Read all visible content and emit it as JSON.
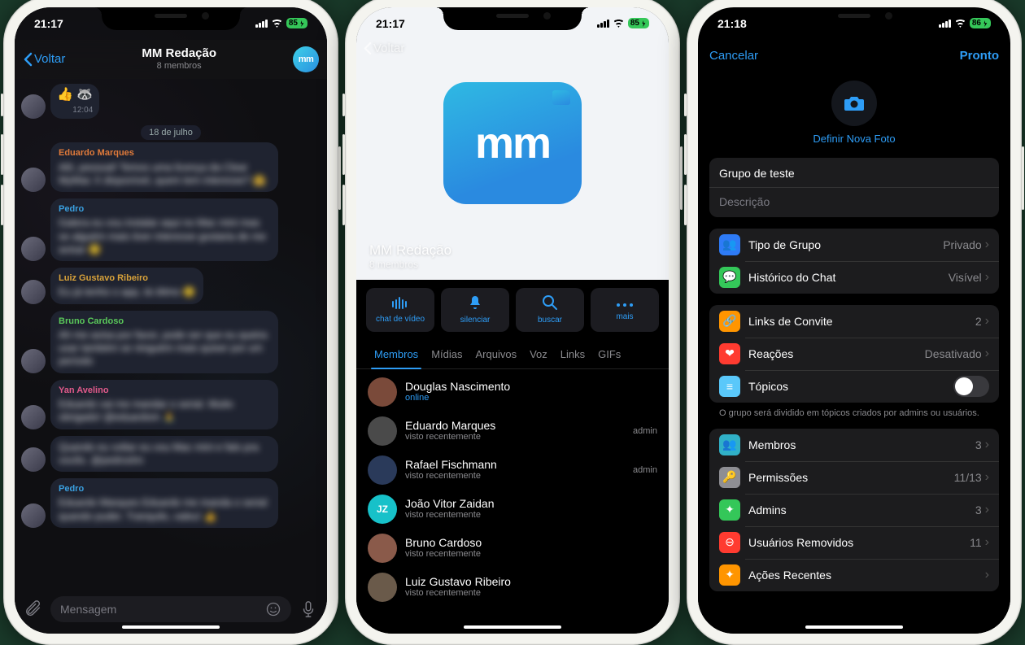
{
  "status": {
    "battery1": "85",
    "battery2": "85",
    "battery3": "86"
  },
  "s1": {
    "time": "21:17",
    "back": "Voltar",
    "title": "MM Redação",
    "subtitle": "8 membros",
    "avatar": "mm",
    "date_sep": "18 de julho",
    "first_time": "12:04",
    "input_placeholder": "Mensagem",
    "msgs": [
      {
        "sender": "",
        "text": "👍 🦝",
        "color": "#e07a3a"
      },
      {
        "sender": "Eduardo Marques",
        "text": "Alô, pessoal! Temos uma licença da Clear MyMac X disponível, quem tem interesse? 🤗",
        "color": "#e07a3a"
      },
      {
        "sender": "Pedro",
        "text": "Galera eu vou instalar aqui no Mac mini mas se alguém mais tiver interesse gostaria de me avisar 🙂",
        "color": "#3aa0e0"
      },
      {
        "sender": "Luiz Gustavo Ribeiro",
        "text": "Eu já tenho o app, tá ótimo 🙂",
        "color": "#d8a23a"
      },
      {
        "sender": "Bruno Cardoso",
        "text": "Ah me avisa por favor, pode ser que eu queira usar também se ninguém mais quiser por um período",
        "color": "#5ac85a"
      },
      {
        "sender": "Yan Avelino",
        "text": "Eduardo vai me mandar o serial. Muito obrigado! @eduardom 🙏",
        "color": "#e05a8a"
      },
      {
        "sender": "",
        "text": "Quando eu voltar eu vou Mac mini e falo pra vocês. @pedroshn",
        "color": "#5a9ae0"
      },
      {
        "sender": "Pedro",
        "text": "Eduardo Marques\nEduardo me manda o serial quando puder. Tranquilo, valeu! 👍",
        "color": "#3aa0e0"
      }
    ]
  },
  "s2": {
    "time": "21:17",
    "back": "Voltar",
    "title": "MM Redação",
    "subtitle": "8 membros",
    "logo": "mm",
    "actions": [
      {
        "id": "video",
        "label": "chat de vídeo"
      },
      {
        "id": "mute",
        "label": "silenciar"
      },
      {
        "id": "search",
        "label": "buscar"
      },
      {
        "id": "more",
        "label": "mais"
      }
    ],
    "tabs": [
      "Membros",
      "Mídias",
      "Arquivos",
      "Voz",
      "Links",
      "GIFs"
    ],
    "members": [
      {
        "first": "Douglas",
        "last": "Nascimento",
        "status": "online",
        "online": true,
        "role": "",
        "init": "",
        "color": "#7a4a3a"
      },
      {
        "first": "Eduardo",
        "last": "Marques",
        "status": "visto recentemente",
        "role": "admin",
        "init": "",
        "color": "#4a4a4a"
      },
      {
        "first": "Rafael",
        "last": "Fischmann",
        "status": "visto recentemente",
        "role": "admin",
        "init": "",
        "color": "#2a3a5a"
      },
      {
        "first": "João Vitor",
        "last": "Zaidan",
        "status": "visto recentemente",
        "role": "",
        "init": "JZ",
        "color": "#17c1c9"
      },
      {
        "first": "Bruno",
        "last": "Cardoso",
        "status": "visto recentemente",
        "role": "",
        "init": "",
        "color": "#8a5a4a"
      },
      {
        "first": "Luiz Gustavo",
        "last": "Ribeiro",
        "status": "visto recentemente",
        "role": "",
        "init": "",
        "color": "#6a5a4a"
      }
    ]
  },
  "s3": {
    "time": "21:18",
    "cancel": "Cancelar",
    "done": "Pronto",
    "set_photo": "Definir Nova Foto",
    "group_name": "Grupo de teste",
    "desc_placeholder": "Descrição",
    "rows": {
      "group_type": {
        "label": "Tipo de Grupo",
        "value": "Privado",
        "icon": "👥",
        "bg": "#2e7bf6"
      },
      "history": {
        "label": "Histórico do Chat",
        "value": "Visível",
        "icon": "💬",
        "bg": "#34c759"
      },
      "invite": {
        "label": "Links de Convite",
        "value": "2",
        "icon": "🔗",
        "bg": "#ff9500"
      },
      "reactions": {
        "label": "Reações",
        "value": "Desativado",
        "icon": "❤︎",
        "bg": "#ff3b30"
      },
      "topics": {
        "label": "Tópicos",
        "icon": "≡",
        "bg": "#5ac8fa"
      },
      "members": {
        "label": "Membros",
        "value": "3",
        "icon": "👥",
        "bg": "#30b0c7"
      },
      "permissions": {
        "label": "Permissões",
        "value": "11/13",
        "icon": "🔑",
        "bg": "#8e8e93"
      },
      "admins": {
        "label": "Admins",
        "value": "3",
        "icon": "✦",
        "bg": "#34c759"
      },
      "removed": {
        "label": "Usuários Removidos",
        "value": "11",
        "icon": "⊖",
        "bg": "#ff3b30"
      },
      "recent": {
        "label": "Ações Recentes",
        "icon": "✦",
        "bg": "#ff9500"
      }
    },
    "topics_caption": "O grupo será dividido em tópicos criados por admins ou usuários."
  }
}
